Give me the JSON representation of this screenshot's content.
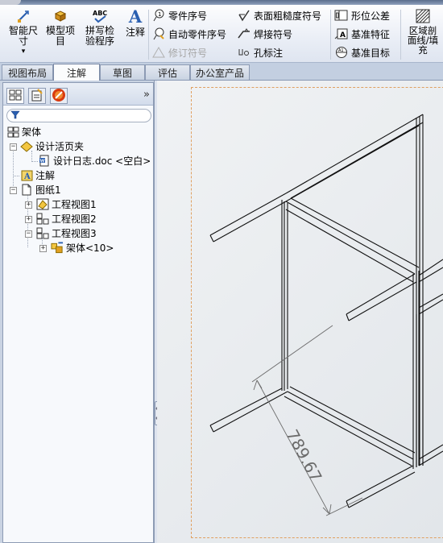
{
  "ribbon": {
    "smart_dimension": "智能尺\n寸",
    "model_items": "模型项\n目",
    "spell_checker": "拼写检\n验程序",
    "note": "注释",
    "balloon": "零件序号",
    "auto_balloon": "自动零件序号",
    "revision_symbol": "修订符号",
    "surface_finish": "表面粗糙度符号",
    "weld_symbol": "焊接符号",
    "hole_callout": "孔标注",
    "geometric_tolerance": "形位公差",
    "datum_feature": "基准特征",
    "datum_target": "基准目标",
    "area_hatch": "区域剖\n面线/填\n充",
    "abc_text": "ABC",
    "a_glyph": "A",
    "dropdown_arrow": "▾"
  },
  "tabs": [
    {
      "label": "视图布局"
    },
    {
      "label": "注解"
    },
    {
      "label": "草图"
    },
    {
      "label": "评估"
    },
    {
      "label": "办公室产品"
    }
  ],
  "panel": {
    "more_chevron": "»",
    "tree": {
      "root": "架体",
      "design_binder": "设计活页夹",
      "design_log": "设计日志.doc <空白>",
      "annotations": "注解",
      "sheet": "图纸1",
      "view1": "工程视图1",
      "view2": "工程视图2",
      "view3": "工程视图3",
      "assembly": "架体<10>"
    }
  },
  "drawing": {
    "dimension_value": "789.67"
  },
  "colors": {
    "ribbon_bg": "#eaeef6",
    "tab_bg": "#c3cfe1",
    "panel_bg": "#f7f9fc",
    "sheet_border": "#e0a060",
    "icon_blue": "#2a5fb0"
  }
}
